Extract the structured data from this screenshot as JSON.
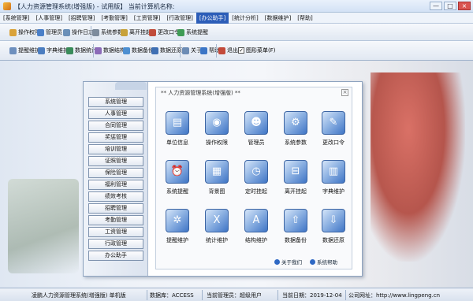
{
  "window": {
    "title": "【人力资源管理系统(增强版) - 试用版】  当前计算机名称:",
    "min": "—",
    "max": "□",
    "close": "×"
  },
  "menu": [
    {
      "label": "[系统管理]",
      "active": false
    },
    {
      "label": "[人事管理]",
      "active": false
    },
    {
      "label": "[招聘管理]",
      "active": false
    },
    {
      "label": "[考勤管理]",
      "active": false
    },
    {
      "label": "[工资管理]",
      "active": false
    },
    {
      "label": "[行政管理]",
      "active": false
    },
    {
      "label": "[办公助手]",
      "active": true
    },
    {
      "label": "[统计分析]",
      "active": false
    },
    {
      "label": "[数据维护]",
      "active": false
    },
    {
      "label": "[帮助]",
      "active": false
    }
  ],
  "toolbar1": {
    "items": [
      {
        "label": "操作权限",
        "icon": "key-icon",
        "color": "#d9a23a"
      },
      {
        "label": "管理员",
        "icon": "user-icon",
        "color": "#4a7fc8"
      },
      {
        "label": "操作日志",
        "icon": "log-icon",
        "color": "#6a8fb8"
      },
      {
        "label": "系统参数",
        "icon": "gear-icon",
        "color": "#7d8b9c"
      },
      {
        "label": "离开挂起",
        "icon": "lock-icon",
        "color": "#c8a23a"
      },
      {
        "label": "更改口令",
        "icon": "password-icon",
        "color": "#c04b3a"
      },
      {
        "label": "系统提醒",
        "icon": "bell-icon",
        "color": "#3f9c55"
      }
    ]
  },
  "toolbar2": {
    "items": [
      {
        "label": "提醒维护",
        "icon": "reminder-icon",
        "color": "#6d8fbe"
      },
      {
        "label": "字典维护",
        "icon": "dictionary-icon",
        "color": "#4b7dc0"
      },
      {
        "label": "数据统计",
        "icon": "statistics-icon",
        "color": "#3a8c5a"
      },
      {
        "label": "数据结构",
        "icon": "structure-icon",
        "color": "#8c6bb8"
      },
      {
        "label": "数据备份",
        "icon": "backup-icon",
        "color": "#4d8fd1"
      },
      {
        "label": "数据还原",
        "icon": "restore-icon",
        "color": "#3f6fb3"
      },
      {
        "label": "关于",
        "icon": "about-icon",
        "color": "#6c8cb5"
      },
      {
        "label": "帮助",
        "icon": "help-icon",
        "color": "#3c76c6"
      },
      {
        "label": "退出",
        "icon": "exit-icon",
        "color": "#c34a3a"
      }
    ],
    "checkbox": {
      "label": "图形菜单(F)",
      "checked": "✓"
    }
  },
  "sidenav": [
    "系统管理",
    "人事管理",
    "合同管理",
    "奖惩管理",
    "培训管理",
    "证照管理",
    "保险管理",
    "福利管理",
    "绩效考核",
    "招聘管理",
    "考勤管理",
    "工资管理",
    "行政管理",
    "办公助手"
  ],
  "panel": {
    "title": "** 人力资源管理系统(增强版) **",
    "close": "×",
    "icons": [
      {
        "label": "单位信息",
        "icon": "company-info-icon",
        "glyph": "▤"
      },
      {
        "label": "操作权限",
        "icon": "permission-icon",
        "glyph": "◉"
      },
      {
        "label": "管理员",
        "icon": "admin-icon",
        "glyph": "☻"
      },
      {
        "label": "系统参数",
        "icon": "settings-icon",
        "glyph": "⚙"
      },
      {
        "label": "更改口令",
        "icon": "change-password-icon",
        "glyph": "✎"
      },
      {
        "label": "系统提醒",
        "icon": "alarm-icon",
        "glyph": "⏰"
      },
      {
        "label": "背景图",
        "icon": "background-image-icon",
        "glyph": "▦"
      },
      {
        "label": "定时挂起",
        "icon": "timer-icon",
        "glyph": "◷"
      },
      {
        "label": "离开挂起",
        "icon": "away-lock-icon",
        "glyph": "⊟"
      },
      {
        "label": "字典维护",
        "icon": "books-icon",
        "glyph": "▥"
      },
      {
        "label": "提醒维护",
        "icon": "gear-maintenance-icon",
        "glyph": "✲"
      },
      {
        "label": "统计维护",
        "icon": "statistics-maint-icon",
        "glyph": "X"
      },
      {
        "label": "结构维护",
        "icon": "structure-maint-icon",
        "glyph": "A"
      },
      {
        "label": "数据备份",
        "icon": "upload-icon",
        "glyph": "⇧"
      },
      {
        "label": "数据还原",
        "icon": "download-icon",
        "glyph": "⇩"
      }
    ],
    "footer": {
      "about": "关于我们",
      "help": "系统帮助"
    }
  },
  "statusbar": {
    "app": "凌鹏人力资源管理系统(增强版) 单机版",
    "db": "数据库：ACCESS",
    "user": "当前管理员：超级用户",
    "date": "当前日期：2019-12-04",
    "site": "公司网址：http://www.lingpeng.cn"
  }
}
